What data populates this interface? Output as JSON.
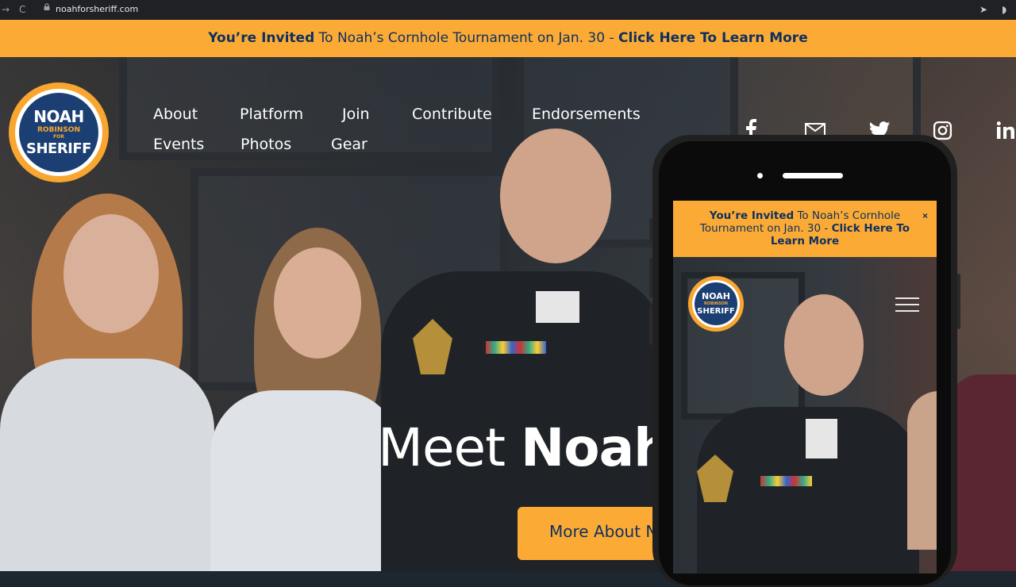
{
  "browser": {
    "back": "→",
    "reload": "C",
    "url": "noahforsheriff.com",
    "send": "➤"
  },
  "banner": {
    "invited": "You’re Invited",
    "text": " To Noah’s Cornhole Tournament on Jan. 30 - ",
    "link": "Click Here To Learn More"
  },
  "logo": {
    "line1": "NOAH",
    "line2": "ROBINSON",
    "line3": "FOR",
    "line4": "SHERIFF"
  },
  "nav": {
    "about": "About",
    "platform": "Platform",
    "join": "Join",
    "contribute": "Contribute",
    "endorsements": "Endorsements",
    "events": "Events",
    "photos": "Photos",
    "gear": "Gear"
  },
  "social": [
    "facebook-icon",
    "email-icon",
    "twitter-icon",
    "instagram-icon",
    "linkedin-icon"
  ],
  "hero": {
    "meet": "Meet ",
    "name": "Noah",
    "cta": "More About Noah"
  },
  "mobile": {
    "invited": "You’re Invited",
    "text": " To Noah’s Cornhole Tournament on Jan. 30 - ",
    "link": "Click Here To Learn More",
    "close": "×",
    "logo_line1": "NOAH",
    "logo_line2": "ROBINSON",
    "logo_line4": "SHERIFF"
  },
  "colors": {
    "accent": "#fbab35",
    "navy": "#0f2f5e",
    "logo_blue": "#1c3f73"
  }
}
